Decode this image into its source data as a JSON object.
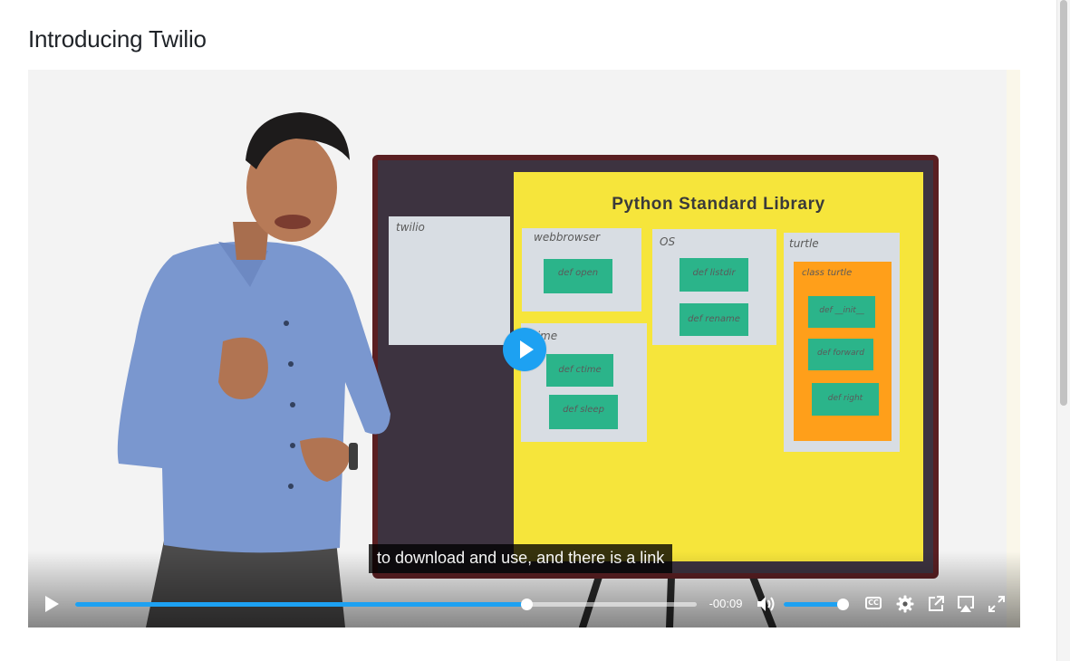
{
  "page": {
    "title": "Introducing Twilio"
  },
  "video": {
    "scene": {
      "board_title": "Python Standard Library",
      "cards": {
        "twilio": "twilio",
        "webbrowser": "webbrowser",
        "os": "OS",
        "turtle": "turtle",
        "time": "time",
        "class_label": "class  turtle"
      },
      "functions": {
        "open": "def open",
        "listdir": "def listdir",
        "rename": "def rename",
        "ctime": "def ctime",
        "sleep": "def sleep",
        "init": "def __init__",
        "forward": "def forward",
        "right": "def right"
      }
    },
    "caption": "to download and use, and there is a link",
    "controls": {
      "time_remaining": "-00:09",
      "progress": 0.726,
      "volume": 0.95,
      "cc_label": "CC"
    }
  },
  "icons": {
    "big_play": "play-icon",
    "play": "play-icon",
    "volume": "volume-icon",
    "cc": "captions-icon",
    "settings": "gear-icon",
    "popout": "external-link-icon",
    "airplay": "airplay-icon",
    "fullscreen": "fullscreen-icon"
  },
  "colors": {
    "accent": "#1da1f2",
    "board_yellow": "#f6e53b",
    "card_green": "#2bb48a",
    "turtle_orange": "#ff9f1a",
    "shirt_blue": "#7a97cf"
  }
}
